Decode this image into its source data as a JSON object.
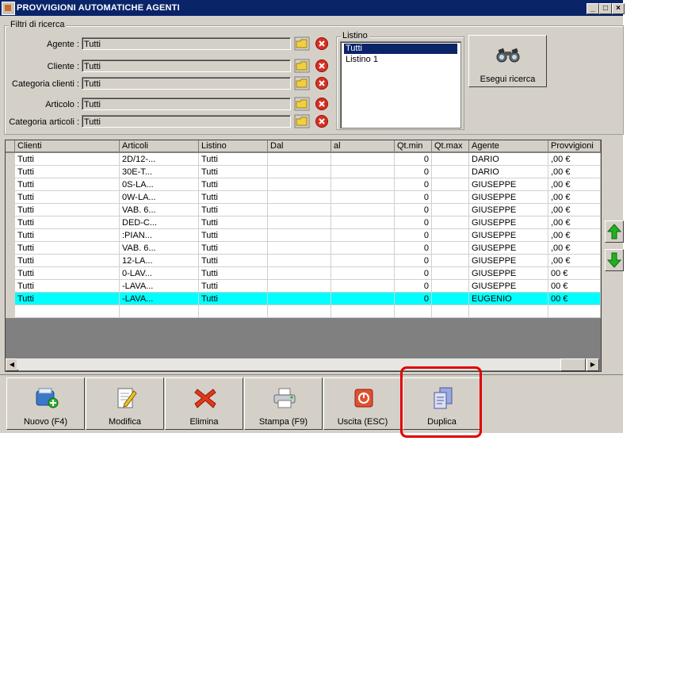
{
  "window": {
    "title": "PROVVIGIONI AUTOMATICHE AGENTI"
  },
  "filters": {
    "group_label": "Filtri di ricerca",
    "rows": [
      {
        "label": "Agente :",
        "value": "Tutti"
      },
      {
        "label": "Cliente :",
        "value": "Tutti"
      },
      {
        "label": "Categoria clienti :",
        "value": "Tutti"
      },
      {
        "label": "Articolo :",
        "value": "Tutti"
      },
      {
        "label": "Categoria articoli :",
        "value": "Tutti"
      }
    ],
    "listino_label": "Listino",
    "listino_items": [
      "Tutti",
      "Listino 1"
    ],
    "listino_selected": "Tutti",
    "search_button": "Esegui ricerca"
  },
  "grid": {
    "columns": [
      "Clienti",
      "Articoli",
      "Listino",
      "Dal",
      "al",
      "Qt.min",
      "Qt.max",
      "Agente",
      "Provvigioni"
    ],
    "rows": [
      {
        "cliente": "Tutti",
        "articolo": "2D/12-...",
        "listino": "Tutti",
        "dal": "",
        "al": "",
        "qtmin": "0",
        "qtmax": "",
        "agente": "DARIO",
        "provvigioni": ",00 €"
      },
      {
        "cliente": "Tutti",
        "articolo": "30E-T...",
        "listino": "Tutti",
        "dal": "",
        "al": "",
        "qtmin": "0",
        "qtmax": "",
        "agente": "DARIO",
        "provvigioni": ",00 €"
      },
      {
        "cliente": "Tutti",
        "articolo": "0S-LA...",
        "listino": "Tutti",
        "dal": "",
        "al": "",
        "qtmin": "0",
        "qtmax": "",
        "agente": "GIUSEPPE",
        "provvigioni": ",00 €"
      },
      {
        "cliente": "Tutti",
        "articolo": "0W-LA...",
        "listino": "Tutti",
        "dal": "",
        "al": "",
        "qtmin": "0",
        "qtmax": "",
        "agente": "GIUSEPPE",
        "provvigioni": ",00 €"
      },
      {
        "cliente": "Tutti",
        "articolo": "VAB. 6...",
        "listino": "Tutti",
        "dal": "",
        "al": "",
        "qtmin": "0",
        "qtmax": "",
        "agente": "GIUSEPPE",
        "provvigioni": ",00 €"
      },
      {
        "cliente": "Tutti",
        "articolo": "DED-C...",
        "listino": "Tutti",
        "dal": "",
        "al": "",
        "qtmin": "0",
        "qtmax": "",
        "agente": "GIUSEPPE",
        "provvigioni": ",00 €"
      },
      {
        "cliente": "Tutti",
        "articolo": ":PIAN...",
        "listino": "Tutti",
        "dal": "",
        "al": "",
        "qtmin": "0",
        "qtmax": "",
        "agente": "GIUSEPPE",
        "provvigioni": ",00 €"
      },
      {
        "cliente": "Tutti",
        "articolo": "VAB. 6...",
        "listino": "Tutti",
        "dal": "",
        "al": "",
        "qtmin": "0",
        "qtmax": "",
        "agente": "GIUSEPPE",
        "provvigioni": ",00 €"
      },
      {
        "cliente": "Tutti",
        "articolo": "12-LA...",
        "listino": "Tutti",
        "dal": "",
        "al": "",
        "qtmin": "0",
        "qtmax": "",
        "agente": "GIUSEPPE",
        "provvigioni": ",00 €"
      },
      {
        "cliente": "Tutti",
        "articolo": "0-LAV...",
        "listino": "Tutti",
        "dal": "",
        "al": "",
        "qtmin": "0",
        "qtmax": "",
        "agente": "GIUSEPPE",
        "provvigioni": "00 €"
      },
      {
        "cliente": "Tutti",
        "articolo": "-LAVA...",
        "listino": "Tutti",
        "dal": "",
        "al": "",
        "qtmin": "0",
        "qtmax": "",
        "agente": "GIUSEPPE",
        "provvigioni": "00 €"
      },
      {
        "cliente": "Tutti",
        "articolo": "-LAVA...",
        "listino": "Tutti",
        "dal": "",
        "al": "",
        "qtmin": "0",
        "qtmax": "",
        "agente": "EUGENIO",
        "provvigioni": "00 €"
      }
    ],
    "selected_row": 11
  },
  "toolbar": {
    "buttons": [
      {
        "name": "nuovo-button",
        "label": "Nuovo (F4)",
        "icon": "new-record-icon"
      },
      {
        "name": "modifica-button",
        "label": "Modifica",
        "icon": "edit-icon"
      },
      {
        "name": "elimina-button",
        "label": "Elimina",
        "icon": "delete-icon"
      },
      {
        "name": "stampa-button",
        "label": "Stampa (F9)",
        "icon": "printer-icon"
      },
      {
        "name": "uscita-button",
        "label": "Uscita (ESC)",
        "icon": "exit-icon"
      },
      {
        "name": "duplica-button",
        "label": "Duplica",
        "icon": "duplicate-icon"
      }
    ]
  },
  "colors": {
    "titlebar": "#0a246a",
    "selected_row": "#00ffff",
    "highlight": "#e00000",
    "window_bg": "#d4d0c8"
  }
}
